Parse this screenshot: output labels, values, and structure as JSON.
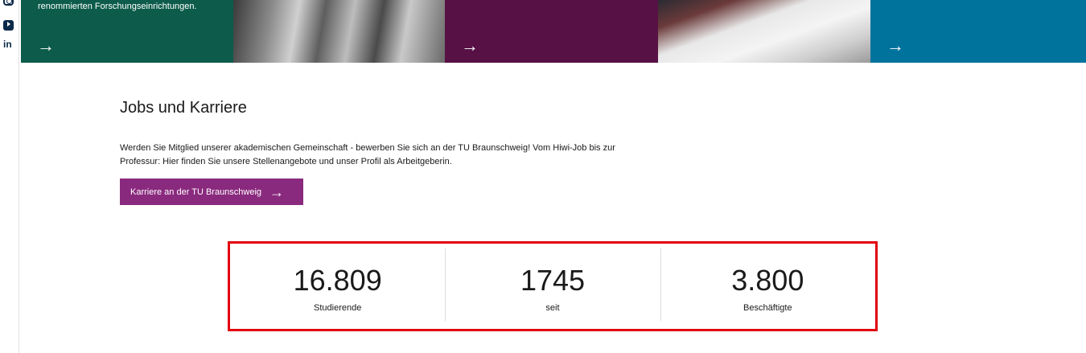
{
  "social": {
    "icons": [
      "instagram-icon",
      "youtube-icon",
      "linkedin-icon"
    ],
    "linkedin_glyph": "in"
  },
  "tiles": [
    {
      "kind": "text",
      "color": "#0d5c4b",
      "text": "renommierten Forschungseinrichtungen.",
      "arrow": "→"
    },
    {
      "kind": "photo"
    },
    {
      "kind": "text",
      "color": "#571145",
      "arrow": "→"
    },
    {
      "kind": "photo"
    },
    {
      "kind": "text",
      "color": "#00739d",
      "arrow": "→"
    }
  ],
  "jobs": {
    "title": "Jobs und Karriere",
    "text": "Werden Sie Mitglied unserer akademischen Gemeinschaft - bewerben Sie sich an der TU Braunschweig! Vom Hiwi-Job bis zur Professur: Hier finden Sie unsere Stellenangebote und unser Profil als Arbeitgeberin.",
    "cta_label": "Karriere an der TU Braunschweig",
    "cta_arrow": "→",
    "cta_color": "#8a2a7e"
  },
  "stats": [
    {
      "value": "16.809",
      "label": "Studierende"
    },
    {
      "value": "1745",
      "label": "seit"
    },
    {
      "value": "3.800",
      "label": "Beschäftigte"
    }
  ],
  "highlight_color": "#e3000f"
}
